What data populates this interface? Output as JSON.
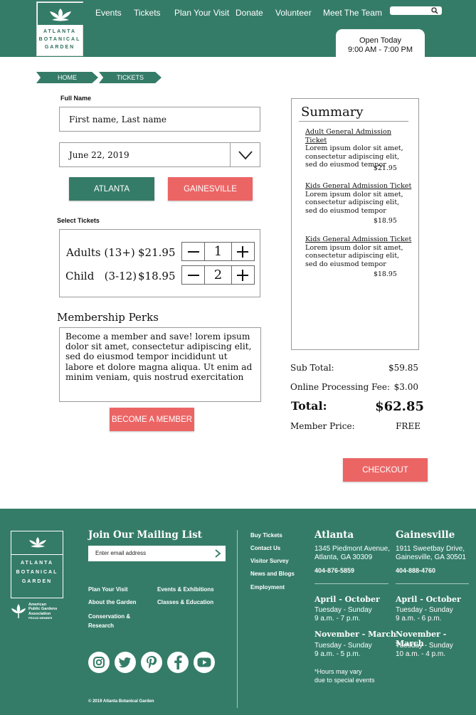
{
  "header": {
    "logo_text": [
      "ATLANTA",
      "BOTANICAL",
      "GARDEN"
    ],
    "nav": [
      "Events",
      "Tickets",
      "Plan Your Visit",
      "Donate",
      "Volunteer",
      "Meet The Team"
    ],
    "hours_title": "Open Today",
    "hours_time": "9:00 AM - 7:00 PM"
  },
  "breadcrumb": [
    "HOME",
    "TICKETS"
  ],
  "form": {
    "full_name_label": "Full Name",
    "name_placeholder": "First name, Last name",
    "date_value": "June 22, 2019",
    "location_options": [
      "ATLANTA",
      "GAINESVILLE"
    ],
    "select_tickets_label": "Select Tickets",
    "tickets": [
      {
        "label": "Adults (13+)",
        "price": "$21.95",
        "qty": "1"
      },
      {
        "label": "Child   (3-12)",
        "price": "$18.95",
        "qty": "2"
      }
    ],
    "perks_title": "Membership Perks",
    "perks_text": "Become a member and save! lorem ipsum dolor sit amet, consectetur adipiscing elit, sed do eiusmod tempor incididunt ut labore et dolore magna aliqua. Ut enim ad minim veniam, quis nostrud exercitation",
    "member_button": "BECOME A MEMBER"
  },
  "summary": {
    "title": "Summary",
    "items": [
      {
        "title": "Adult General Admission Ticket",
        "desc": "Lorem ipsum dolor sit amet, consectetur adipiscing elit, sed do eiusmod tempor",
        "price": "$21.95"
      },
      {
        "title": "Kids General Admission Ticket",
        "desc": "Lorem ipsum dolor sit amet, consectetur adipiscing elit, sed do eiusmod tempor",
        "price": "$18.95"
      },
      {
        "title": "Kids General Admission Ticket",
        "desc": "Lorem ipsum dolor sit amet, consectetur adipiscing elit, sed do eiusmod tempor",
        "price": "$18.95"
      }
    ],
    "subtotal_label": "Sub Total:",
    "subtotal": "$59.85",
    "fee_label": "Online Processing Fee:",
    "fee": "$3.00",
    "total_label": "Total:",
    "total": "$62.85",
    "member_label": "Member Price:",
    "member_price": "FREE",
    "checkout": "CHECKOUT"
  },
  "footer": {
    "logo_text": [
      "ATLANTA",
      "BOTANICAL",
      "GARDEN"
    ],
    "apga_text": [
      "American",
      "Public Gardens",
      "Association"
    ],
    "apga_sub": "PROUD MEMBER",
    "mailing_title": "Join Our Mailing List",
    "email_placeholder": "Enter email address",
    "links_left": [
      "Plan Your Visit",
      "About the Garden",
      "Conservation &",
      "Research"
    ],
    "links_right": [
      "Events & Exhibitions",
      "Classes & Education"
    ],
    "links_mid": [
      "Buy Tickets",
      "Contact Us",
      "Visitor Survey",
      "News and Blogs",
      "Employment"
    ],
    "atlanta": {
      "name": "Atlanta",
      "addr1": "1345 Piedmont Avenue,",
      "addr2": "Atlanta, GA 30309",
      "phone": "404-876-5859",
      "s1": "April - October",
      "s1a": "Tuesday - Sunday",
      "s1b": "9 a.m. - 7 p.m.",
      "s2": "November - March",
      "s2a": "Tuesday - Sunday",
      "s2b": "9 a.m. - 5 p.m.",
      "note1": "*Hours may vary",
      "note2": "due to special events"
    },
    "gainesville": {
      "name": "Gainesville",
      "addr1": "1911 Sweetbay Drive,",
      "addr2": "Gainesville, GA 30501",
      "phone": "404-888-4760",
      "s1": "April - October",
      "s1a": "Tuesday - Sunday",
      "s1b": "9 a.m. - 6 p.m.",
      "s2": "November - March",
      "s2a": "Tuesday - Sunday",
      "s2b": "10 a.m. - 4 p.m."
    },
    "copyright": "© 2019 Atlanta Botanical Garden"
  },
  "colors": {
    "brand_green": "#357c68",
    "accent_red": "#ec6565"
  }
}
